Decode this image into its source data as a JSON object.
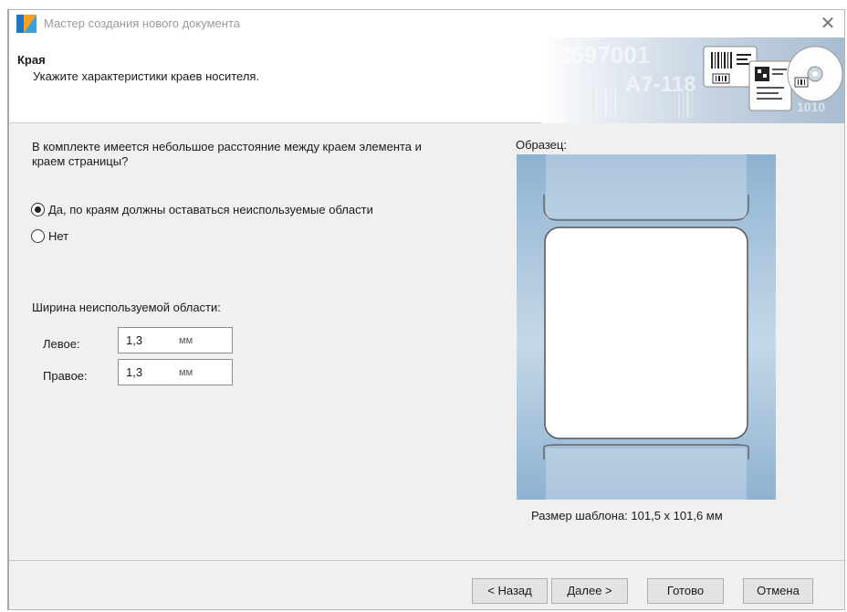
{
  "window": {
    "title": "Мастер создания нового документа",
    "close_glyph": "✕"
  },
  "header": {
    "title": "Края",
    "subtitle": "Укажите характеристики краев носителя.",
    "graphic_texts": [
      "3597001",
      "A7-118",
      "1010"
    ]
  },
  "main": {
    "prompt": "В комплекте имеется небольшое расстояние между краем элемента и краем страницы?",
    "options": [
      {
        "label": "Да, по краям должны оставаться неиспользуемые области",
        "checked": true
      },
      {
        "label": "Нет",
        "checked": false
      }
    ],
    "width_label": "Ширина неиспользуемой области:",
    "fields": [
      {
        "label": "Левое:",
        "value": "1,3",
        "unit": "мм"
      },
      {
        "label": "Правое:",
        "value": "1,3",
        "unit": "мм"
      }
    ]
  },
  "sample": {
    "label": "Образец:",
    "size_text": "Размер шаблона:  101,5 x 101,6 мм"
  },
  "buttons": {
    "back": "< Назад",
    "next": "Далее >",
    "finish": "Готово",
    "cancel": "Отмена"
  },
  "colors": {
    "sample_blue": "#8eb2d1",
    "logo_blue": "#1e74c6",
    "logo_orange": "#f7a21b"
  }
}
